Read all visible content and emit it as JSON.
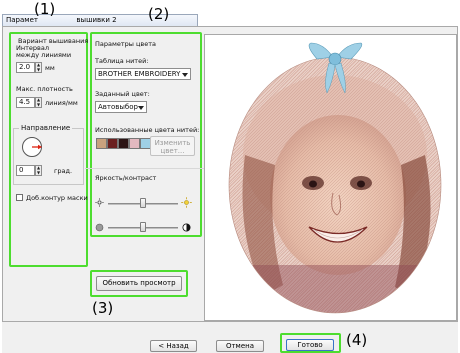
{
  "window": {
    "tab_prefix": "Парамет",
    "tab_suffix": "вышивки 2"
  },
  "callouts": [
    "(1)",
    "(2)",
    "(3)",
    "(4)"
  ],
  "left_panel": {
    "group_title": "Вариант вышивания",
    "interval_label_1": "Интервал",
    "interval_label_2": "между линиями",
    "interval_value": "2.0",
    "interval_unit": "мм",
    "density_label": "Макс. плотность",
    "density_value": "4.5",
    "density_unit": "линия/мм",
    "direction_title": "Направление",
    "angle_value": "0",
    "angle_unit": "град.",
    "extra_contour_label": "Доб.контур маски"
  },
  "color_panel": {
    "title": "Параметры цвета",
    "table_label": "Таблица нитей:",
    "table_value": "BROTHER EMBROIDERY",
    "preset_label": "Заданный цвет:",
    "preset_value": "Автовыбор",
    "used_label": "Использованные цвета нитей:",
    "used_colors": [
      "#c9a27e",
      "#6b2020",
      "#2b1414",
      "#e3b9c0",
      "#9fd0e6"
    ],
    "change_color_line1": "Изменить",
    "change_color_line2": "цвет...",
    "brightness_label": "Яркость/контраст",
    "brightness_level": 0.5,
    "contrast_level": 0.5
  },
  "buttons": {
    "refresh": "Обновить просмотр",
    "back": "< Назад",
    "cancel": "Отмена",
    "done": "Готово"
  },
  "colors": {
    "highlight": "#4ddd2f"
  }
}
